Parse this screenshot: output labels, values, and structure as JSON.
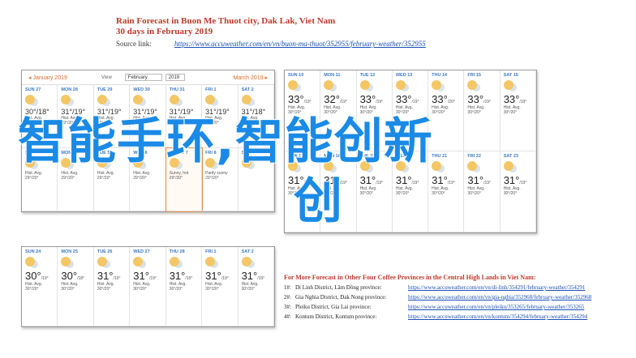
{
  "header": {
    "title": "Rain Forecast in Buon Me Thuot city, Dak Lak, Viet Nam",
    "subtitle": "30 days in February 2019",
    "source_label": "Source link:",
    "source_url": "https://www.accuweather.com/en/vn/buon-ma-thuot/352955/february-weather/352955"
  },
  "calendar_top": {
    "prev_month": "◂ January 2019",
    "view_label": "View",
    "month_select": "February",
    "year_select": "2019",
    "next_month": "March 2019 ▸",
    "weekdays": [
      "SUN",
      "MON",
      "TUE",
      "WED",
      "THU",
      "FRI",
      "SAT"
    ],
    "rows": [
      [
        {
          "d": "SUN 27",
          "t": "30°/18°",
          "note": "Hist. Avg.",
          "avg": "29°/20°"
        },
        {
          "d": "MON 28",
          "t": "31°/19°",
          "note": "Hist. Avg.",
          "avg": "29°/20°"
        },
        {
          "d": "TUE 29",
          "t": "31°/19°",
          "note": "Hist. Avg.",
          "avg": "29°/20°"
        },
        {
          "d": "WED 30",
          "t": "31°/19°",
          "note": "Hist. Avg.",
          "avg": "29°/20°"
        },
        {
          "d": "THU 31",
          "t": "31°/19°",
          "note": "Hist. Avg.",
          "avg": "29°/20°"
        },
        {
          "d": "FRI 1",
          "t": "31°/19°",
          "note": "Hist. Avg.",
          "avg": "29°/20°"
        },
        {
          "d": "SAT 2",
          "t": "31°/18°",
          "note": "Hist. Avg.",
          "avg": "29°/20°"
        }
      ],
      [
        {
          "d": "SUN 3",
          "t": "",
          "note": "Hist. Avg.",
          "avg": "29°/20°"
        },
        {
          "d": "MON 4",
          "t": "",
          "note": "Hist. Avg.",
          "avg": "29°/20°"
        },
        {
          "d": "TUE 5",
          "t": "",
          "note": "Hist. Avg.",
          "avg": "29°/20°"
        },
        {
          "d": "WED 6",
          "t": "",
          "note": "Hist. Avg.",
          "avg": "29°/20°"
        },
        {
          "d": "TODAY 7",
          "t": "",
          "note": "Sunny, hot",
          "avg": "29°/20°"
        },
        {
          "d": "FRI 8",
          "t": "",
          "note": "Partly sunny",
          "avg": "29°/20°"
        },
        {
          "d": "SAT 9",
          "t": "",
          "note": "",
          "avg": ""
        }
      ]
    ]
  },
  "calendar_mid": {
    "days": [
      {
        "d": "SUN 10",
        "hi": "33°",
        "lo": "/19°",
        "note": "Hist. Avg.",
        "avg": "30°/20°"
      },
      {
        "d": "MON 11",
        "hi": "32°",
        "lo": "/19°",
        "note": "Hist. Avg.",
        "avg": "30°/20°"
      },
      {
        "d": "TUE 12",
        "hi": "33°",
        "lo": "/19°",
        "note": "Hist. Avg.",
        "avg": "30°/20°"
      },
      {
        "d": "WED 13",
        "hi": "33°",
        "lo": "/19°",
        "note": "Hist. Avg.",
        "avg": "30°/20°"
      },
      {
        "d": "THU 14",
        "hi": "33°",
        "lo": "/20°",
        "note": "Hist. Avg.",
        "avg": "30°/20°"
      },
      {
        "d": "FRI 15",
        "hi": "33°",
        "lo": "/19°",
        "note": "Hist. Avg.",
        "avg": "30°/20°"
      },
      {
        "d": "SAT 16",
        "hi": "33°",
        "lo": "/19°",
        "note": "Hist. Avg.",
        "avg": "30°/20°"
      }
    ],
    "days2": [
      {
        "d": "SUN 17",
        "hi": "31°",
        "lo": "/19°",
        "note": "Hist. Avg.",
        "avg": "30°/20°"
      },
      {
        "d": "MON 18",
        "hi": "31°",
        "lo": "/19°",
        "note": "Hist. Avg.",
        "avg": "30°/20°"
      },
      {
        "d": "TUE 19",
        "hi": "31°",
        "lo": "/19°",
        "note": "Hist. Avg.",
        "avg": "30°/20°"
      },
      {
        "d": "WED 20",
        "hi": "31°",
        "lo": "/19°",
        "note": "Hist. Avg.",
        "avg": "30°/20°"
      },
      {
        "d": "THU 21",
        "hi": "31°",
        "lo": "/19°",
        "note": "Hist. Avg.",
        "avg": "30°/20°"
      },
      {
        "d": "FRI 22",
        "hi": "31°",
        "lo": "/19°",
        "note": "Hist. Avg.",
        "avg": "30°/20°"
      },
      {
        "d": "SAT 23",
        "hi": "31°",
        "lo": "/19°",
        "note": "Hist. Avg.",
        "avg": "30°/20°"
      }
    ]
  },
  "calendar_bottom": {
    "days": [
      {
        "d": "SUN 24",
        "hi": "30°",
        "lo": "/19°",
        "note": "Hist. Avg.",
        "avg": "30°/20°"
      },
      {
        "d": "MON 25",
        "hi": "30°",
        "lo": "/18°",
        "note": "Hist. Avg.",
        "avg": "30°/20°"
      },
      {
        "d": "TUE 26",
        "hi": "31°",
        "lo": "/19°",
        "note": "Hist. Avg.",
        "avg": "30°/20°"
      },
      {
        "d": "WED 27",
        "hi": "31°",
        "lo": "/19°",
        "note": "Hist. Avg.",
        "avg": "30°/20°"
      },
      {
        "d": "THU 28",
        "hi": "31°",
        "lo": "/19°",
        "note": "Hist. Avg.",
        "avg": "30°/20°"
      },
      {
        "d": "FRI 1",
        "hi": "31°",
        "lo": "/19°",
        "note": "Hist. Avg.",
        "avg": "30°/20°"
      },
      {
        "d": "SAT 2",
        "hi": "31°",
        "lo": "/19°",
        "note": "Hist. Avg.",
        "avg": "30°/20°"
      }
    ]
  },
  "more": {
    "title": "For More Forecast in Other Four Coffee Provinces in the Central High Lands in Viet Nam:",
    "items": [
      {
        "n": "1#:",
        "name": "Di Linh District, Lâm Đồng province:",
        "url": "https://www.accuweather.com/en/vn/di-linh/354291/february-weather/354291"
      },
      {
        "n": "2#:",
        "name": "Gia Nghia District, Dak Nong province:",
        "url": "https://www.accuweather.com/en/vn/gia-nghia/352968/february-weather/352968"
      },
      {
        "n": "3#:",
        "name": "Pleiku District, Gia Lai province:",
        "url": "https://www.accuweather.com/en/vn/pleiku/353265/february-weather/353265"
      },
      {
        "n": "4#:",
        "name": "Kontum District, Kontum province:",
        "url": "https://www.accuweather.com/en/vn/kontum/354294/february-weather/354294"
      }
    ]
  },
  "overlay": {
    "line1": "智能手环,智能创新",
    "line2": "创"
  },
  "colors": {
    "accent": "#c0392b",
    "link": "#1a4fb5",
    "overlay_text": "#1a8ae6",
    "sun": "#f4b942"
  }
}
